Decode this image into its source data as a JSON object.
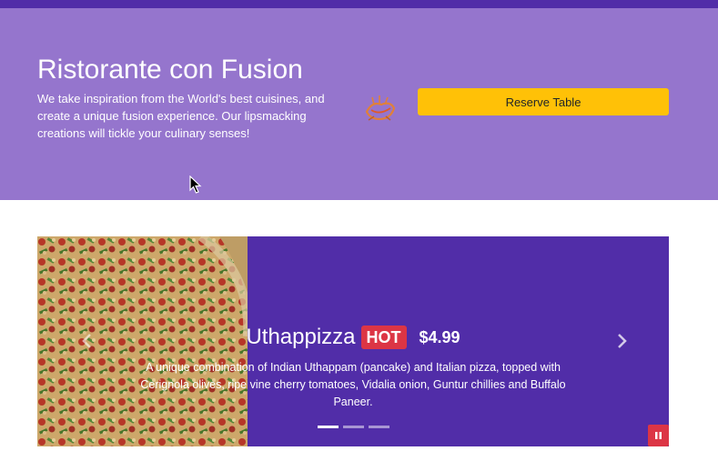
{
  "jumbotron": {
    "title": "Ristorante con Fusion",
    "tagline": "We take inspiration from the World's best cuisines, and create a unique fusion experience. Our lipsmacking creations will tickle your culinary senses!",
    "reserve_label": "Reserve Table",
    "logo_icon": "restaurant-logo-icon"
  },
  "carousel": {
    "slide": {
      "name": "Uthappizza",
      "badge": "HOT",
      "price": "$4.99",
      "description": "A unique combination of Indian Uthappam (pancake) and Italian pizza, topped with Cerignola olives, ripe vine cherry tomatoes, Vidalia onion, Guntur chillies and Buffalo Paneer."
    },
    "indicators": {
      "count": 3,
      "active": 0
    },
    "colors": {
      "background": "#512da8",
      "badge": "#dc3545",
      "pause": "#dc3545"
    }
  },
  "colors": {
    "topbar": "#512da8",
    "jumbotron": "#9575cd",
    "reserve_button": "#ffc107"
  }
}
